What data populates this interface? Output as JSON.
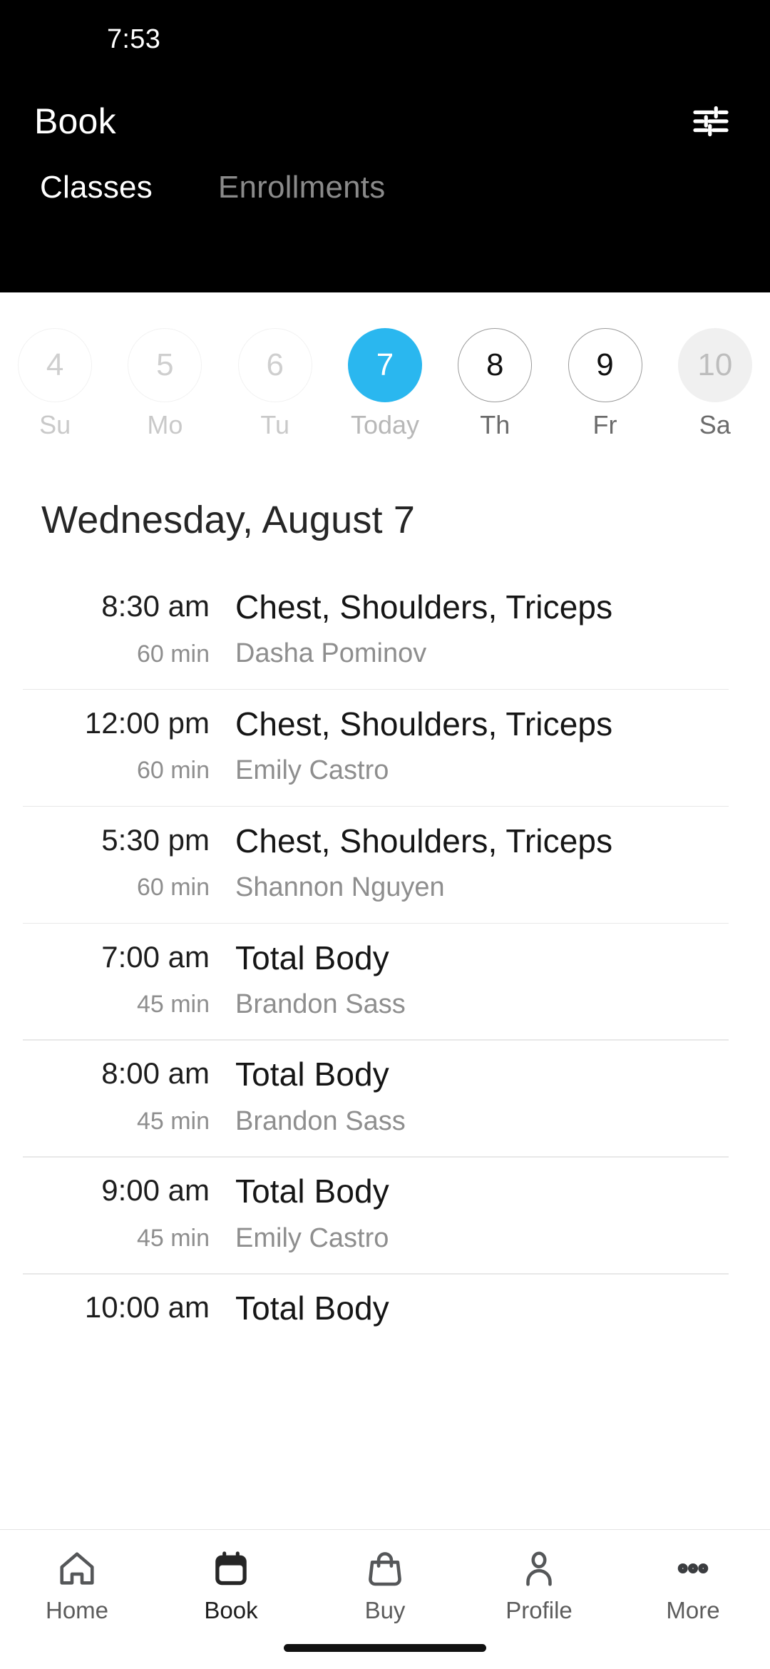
{
  "statusbar": {
    "time": "7:53"
  },
  "appbar": {
    "title": "Book",
    "filter_icon": "sliders-filter-icon"
  },
  "tabs": [
    {
      "label": "Classes",
      "active": true
    },
    {
      "label": "Enrollments",
      "active": false
    }
  ],
  "datestrip": [
    {
      "day": "4",
      "weekday": "Su",
      "state": "disabled"
    },
    {
      "day": "5",
      "weekday": "Mo",
      "state": "disabled"
    },
    {
      "day": "6",
      "weekday": "Tu",
      "state": "disabled"
    },
    {
      "day": "7",
      "weekday": "Today",
      "state": "today"
    },
    {
      "day": "8",
      "weekday": "Th",
      "state": "normal"
    },
    {
      "day": "9",
      "weekday": "Fr",
      "state": "normal"
    },
    {
      "day": "10",
      "weekday": "Sa",
      "state": "filled"
    }
  ],
  "date_heading": "Wednesday, August 7",
  "classes": [
    {
      "time": "8:30 am",
      "duration": "60 min",
      "title": "Chest, Shoulders, Triceps",
      "instructor": "Dasha Pominov"
    },
    {
      "time": "12:00 pm",
      "duration": "60 min",
      "title": "Chest, Shoulders, Triceps",
      "instructor": "Emily Castro"
    },
    {
      "time": "5:30 pm",
      "duration": "60 min",
      "title": "Chest, Shoulders, Triceps",
      "instructor": "Shannon Nguyen"
    },
    {
      "time": "7:00 am",
      "duration": "45 min",
      "title": "Total Body",
      "instructor": "Brandon Sass"
    },
    {
      "time": "8:00 am",
      "duration": "45 min",
      "title": "Total Body",
      "instructor": "Brandon Sass"
    },
    {
      "time": "9:00 am",
      "duration": "45 min",
      "title": "Total Body",
      "instructor": "Emily Castro"
    },
    {
      "time": "10:00 am",
      "duration": "",
      "title": "Total Body",
      "instructor": ""
    }
  ],
  "bottomnav": [
    {
      "label": "Home",
      "icon": "home-icon",
      "active": false
    },
    {
      "label": "Book",
      "icon": "calendar-icon",
      "active": true
    },
    {
      "label": "Buy",
      "icon": "bag-icon",
      "active": false
    },
    {
      "label": "Profile",
      "icon": "person-icon",
      "active": false
    },
    {
      "label": "More",
      "icon": "more-dots-icon",
      "active": false
    }
  ],
  "colors": {
    "accent": "#2ab7ef",
    "header_bg": "#000000",
    "page_bg": "#ffffff",
    "muted_text": "#8e8e8e"
  }
}
